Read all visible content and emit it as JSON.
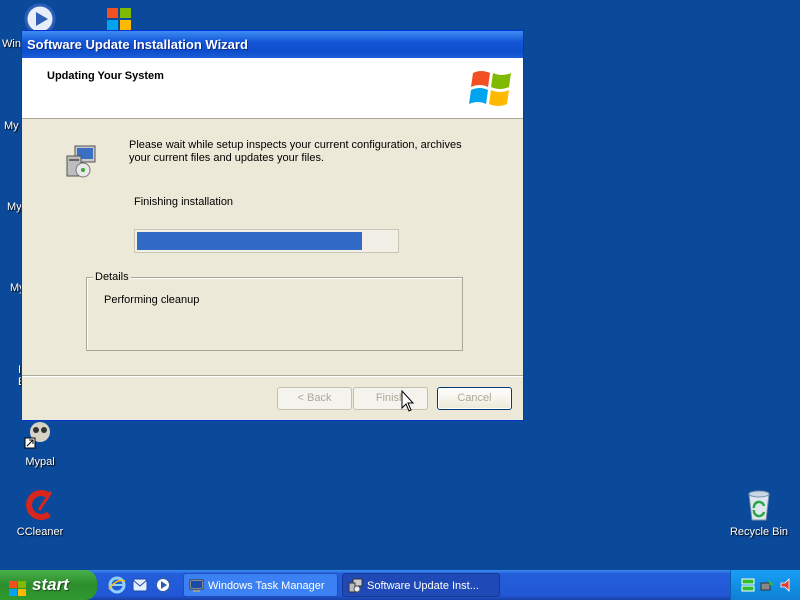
{
  "desktop": {
    "icons": [
      {
        "label": "Wine"
      },
      {
        "label": ""
      },
      {
        "label": "Mypal"
      },
      {
        "label": "CCleaner"
      },
      {
        "label": "Recycle Bin"
      }
    ],
    "partial_labels": [
      "My",
      "My",
      "My",
      "I",
      "E"
    ]
  },
  "wizard": {
    "title": "Software Update Installation Wizard",
    "header": "Updating Your System",
    "description": "Please wait while setup inspects your current configuration, archives your current files and updates your files.",
    "status": "Finishing installation",
    "progress_percent": 87,
    "details_legend": "Details",
    "details_text": "Performing cleanup",
    "buttons": {
      "back": "< Back",
      "finish": "Finish",
      "cancel": "Cancel"
    },
    "colors": {
      "progress": "#316ac5",
      "titlebar": "#0d4ecb"
    }
  },
  "taskbar": {
    "start_label": "start",
    "quick_launch": [
      "internet-explorer-icon",
      "outlook-icon",
      "media-player-icon"
    ],
    "tasks": [
      {
        "label": "Windows Task Manager",
        "active": false
      },
      {
        "label": "Software Update Inst...",
        "active": true
      }
    ]
  }
}
